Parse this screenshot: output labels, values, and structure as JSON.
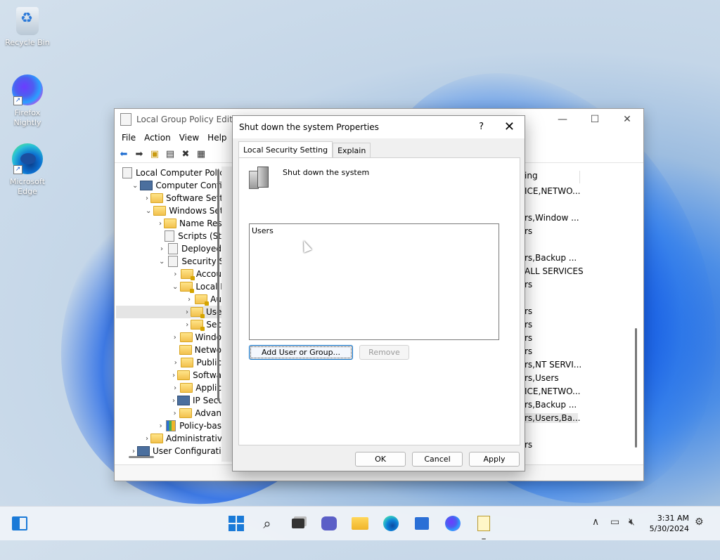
{
  "desktop": {
    "icons": [
      {
        "label": "Recycle Bin"
      },
      {
        "label": "Firefox Nightly"
      },
      {
        "label": "Microsoft Edge"
      }
    ]
  },
  "gpe": {
    "title": "Local Group Policy Editor",
    "menu": [
      "File",
      "Action",
      "View",
      "Help"
    ],
    "window_buttons": {
      "minimize": "—",
      "maximize": "☐",
      "close": "✕"
    },
    "tree": [
      {
        "label": "Local Computer Polic",
        "indent": 0,
        "chevron": "",
        "icon": "doc"
      },
      {
        "label": "Computer Config",
        "indent": 1,
        "chevron": "⌄",
        "icon": "pc"
      },
      {
        "label": "Software Setti",
        "indent": 2,
        "chevron": "›",
        "icon": "folder"
      },
      {
        "label": "Windows Sett",
        "indent": 2,
        "chevron": "⌄",
        "icon": "folder"
      },
      {
        "label": "Name Res",
        "indent": 3,
        "chevron": "›",
        "icon": "folder"
      },
      {
        "label": "Scripts (St",
        "indent": 3,
        "chevron": "",
        "icon": "doc"
      },
      {
        "label": "Deployed",
        "indent": 3,
        "chevron": "›",
        "icon": "doc"
      },
      {
        "label": "Security Se",
        "indent": 3,
        "chevron": "⌄",
        "icon": "doc"
      },
      {
        "label": "Accou",
        "indent": 4,
        "chevron": "›",
        "icon": "folder-lock"
      },
      {
        "label": "Local P",
        "indent": 4,
        "chevron": "⌄",
        "icon": "folder-lock"
      },
      {
        "label": "Au",
        "indent": 5,
        "chevron": "›",
        "icon": "folder-lock"
      },
      {
        "label": "Use",
        "indent": 5,
        "chevron": "›",
        "icon": "folder-lock",
        "selected": true
      },
      {
        "label": "Sec",
        "indent": 5,
        "chevron": "›",
        "icon": "folder-lock"
      },
      {
        "label": "Windo",
        "indent": 4,
        "chevron": "›",
        "icon": "folder"
      },
      {
        "label": "Netwo",
        "indent": 4,
        "chevron": "",
        "icon": "folder"
      },
      {
        "label": "Public",
        "indent": 4,
        "chevron": "›",
        "icon": "folder"
      },
      {
        "label": "Softwa",
        "indent": 4,
        "chevron": "›",
        "icon": "folder"
      },
      {
        "label": "Applic",
        "indent": 4,
        "chevron": "›",
        "icon": "folder"
      },
      {
        "label": "IP Secu",
        "indent": 4,
        "chevron": "›",
        "icon": "pc"
      },
      {
        "label": "Advan",
        "indent": 4,
        "chevron": "›",
        "icon": "folder"
      },
      {
        "label": "Policy-bas",
        "indent": 3,
        "chevron": "›",
        "icon": "chart"
      },
      {
        "label": "Administrativ",
        "indent": 2,
        "chevron": "›",
        "icon": "folder"
      },
      {
        "label": "User Configuratio",
        "indent": 1,
        "chevron": "›",
        "icon": "pc"
      }
    ],
    "right_column": {
      "header": "ing",
      "rows": [
        "ICE,NETWO...",
        "",
        "rs,Window ...",
        "rs",
        "",
        "rs,Backup ...",
        "ALL SERVICES",
        "rs",
        "",
        "rs",
        "rs",
        "rs",
        "rs",
        "rs,NT SERVI...",
        "rs,Users",
        "ICE,NETWO...",
        "rs,Backup ...",
        "rs,Users,Ba...",
        "",
        "rs"
      ],
      "selected_index": 17
    }
  },
  "dialog": {
    "title": "Shut down the system Properties",
    "help": "?",
    "close": "✕",
    "tabs": [
      {
        "label": "Local Security Setting",
        "active": true
      },
      {
        "label": "Explain",
        "active": false
      }
    ],
    "policy_name": "Shut down the system",
    "list_items": [
      "Users"
    ],
    "add_button": "Add User or Group...",
    "remove_button": "Remove",
    "ok": "OK",
    "cancel": "Cancel",
    "apply": "Apply"
  },
  "taskbar": {
    "time": "3:31 AM",
    "date": "5/30/2024",
    "tray_chevron": "∧"
  }
}
